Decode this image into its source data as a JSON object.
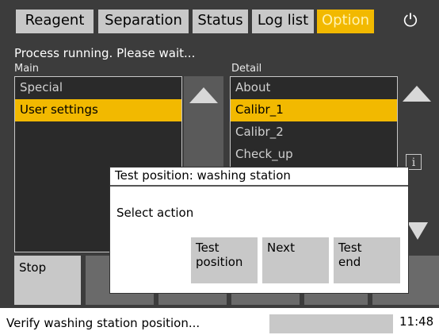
{
  "tabs": [
    {
      "label": "Reagent"
    },
    {
      "label": "Separation"
    },
    {
      "label": "Status"
    },
    {
      "label": "Log list"
    },
    {
      "label": "Option",
      "active": true
    }
  ],
  "power_icon": "power-icon",
  "status_message": "Process running. Please wait...",
  "main": {
    "label": "Main",
    "items": [
      "Special",
      "User settings"
    ],
    "selected_index": 1
  },
  "detail": {
    "label": "Detail",
    "items": [
      "About",
      "Calibr_1",
      "Calibr_2",
      "Check_up"
    ],
    "selected_index": 1
  },
  "info_icon": "i",
  "bottom": {
    "stop_label": "Stop"
  },
  "dialog": {
    "title": "Test position: washing station",
    "message": "Select action",
    "buttons": [
      "Test\nposition",
      "Next",
      "Test\nend"
    ]
  },
  "footer": {
    "message": "Verify washing station position...",
    "time": "11:48"
  },
  "colors": {
    "accent": "#f2b900",
    "background": "#3c3c3c",
    "button": "#c8c8c8"
  }
}
